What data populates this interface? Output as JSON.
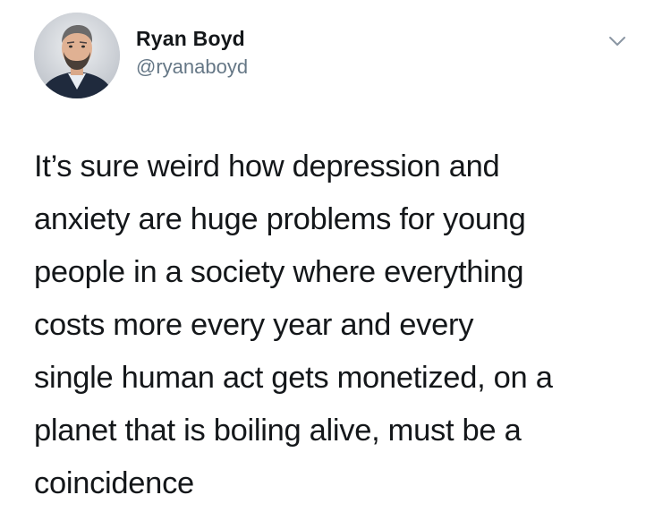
{
  "author": {
    "display_name": "Ryan Boyd",
    "handle": "@ryanaboyd",
    "avatar_icon": "profile-photo",
    "more_icon": "chevron-down-icon"
  },
  "tweet": {
    "lines": [
      "It’s sure weird how depression and",
      "anxiety are huge problems for young",
      "people in a society where everything",
      "costs more every year and every",
      "single human act gets monetized, on a",
      "planet that is boiling alive, must be a",
      "coincidence"
    ]
  },
  "colors": {
    "text": "#14171a",
    "secondary": "#657786",
    "background": "#ffffff"
  }
}
